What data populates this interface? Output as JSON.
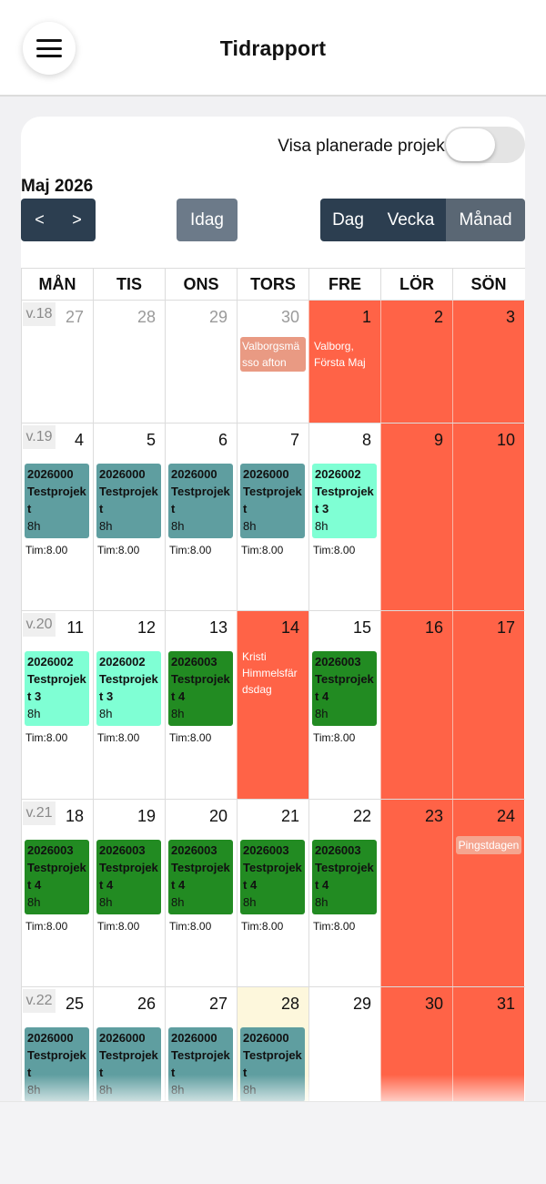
{
  "header": {
    "title": "Tidrapport",
    "menu_icon": "hamburger-icon"
  },
  "toolbar": {
    "toggle_label": "Visa planerade projekt",
    "toggle_on": false,
    "month": "Maj 2026",
    "prev": "<",
    "next": ">",
    "today": "Idag",
    "views": [
      "Dag",
      "Vecka",
      "Månad"
    ],
    "active_view": "Månad"
  },
  "colors": {
    "weekend": "#ff6347",
    "teal": "#5f9ea0",
    "aqua": "#7fffd4",
    "green": "#228b22",
    "nav": "#2c3e50"
  },
  "calendar": {
    "weekdays": [
      "MÅN",
      "TIS",
      "ONS",
      "TORS",
      "FRE",
      "LÖR",
      "SÖN"
    ],
    "weeks": [
      {
        "label": "v.18",
        "days": [
          {
            "n": "27"
          },
          {
            "n": "28"
          },
          {
            "n": "29"
          },
          {
            "n": "30",
            "holiday": "Valborgsmä sso afton"
          },
          {
            "n": "1",
            "holiday": "Valborg, Första Maj"
          },
          {
            "n": "2"
          },
          {
            "n": "3"
          }
        ]
      },
      {
        "label": "v.19",
        "days": [
          {
            "n": "4",
            "code": "2026000",
            "name": "Testprojek t",
            "hours": "8h",
            "tim": "Tim:8.00"
          },
          {
            "n": "5",
            "code": "2026000",
            "name": "Testprojek t",
            "hours": "8h",
            "tim": "Tim:8.00"
          },
          {
            "n": "6",
            "code": "2026000",
            "name": "Testprojek t",
            "hours": "8h",
            "tim": "Tim:8.00"
          },
          {
            "n": "7",
            "code": "2026000",
            "name": "Testprojek t",
            "hours": "8h",
            "tim": "Tim:8.00"
          },
          {
            "n": "8",
            "code": "2026002",
            "name": "Testprojek t 3",
            "hours": "8h",
            "tim": "Tim:8.00"
          },
          {
            "n": "9"
          },
          {
            "n": "10"
          }
        ]
      },
      {
        "label": "v.20",
        "days": [
          {
            "n": "11",
            "code": "2026002",
            "name": "Testprojek t 3",
            "hours": "8h",
            "tim": "Tim:8.00"
          },
          {
            "n": "12",
            "code": "2026002",
            "name": "Testprojek t 3",
            "hours": "8h",
            "tim": "Tim:8.00"
          },
          {
            "n": "13",
            "code": "2026003",
            "name": "Testprojek t 4",
            "hours": "8h",
            "tim": "Tim:8.00"
          },
          {
            "n": "14",
            "holiday": "Kristi Himmelsfär dsdag"
          },
          {
            "n": "15",
            "code": "2026003",
            "name": "Testprojek t 4",
            "hours": "8h",
            "tim": "Tim:8.00"
          },
          {
            "n": "16"
          },
          {
            "n": "17"
          }
        ]
      },
      {
        "label": "v.21",
        "days": [
          {
            "n": "18",
            "code": "2026003",
            "name": "Testprojek t 4",
            "hours": "8h",
            "tim": "Tim:8.00"
          },
          {
            "n": "19",
            "code": "2026003",
            "name": "Testprojek t 4",
            "hours": "8h",
            "tim": "Tim:8.00"
          },
          {
            "n": "20",
            "code": "2026003",
            "name": "Testprojek t 4",
            "hours": "8h",
            "tim": "Tim:8.00"
          },
          {
            "n": "21",
            "code": "2026003",
            "name": "Testprojek t 4",
            "hours": "8h",
            "tim": "Tim:8.00"
          },
          {
            "n": "22",
            "code": "2026003",
            "name": "Testprojek t 4",
            "hours": "8h",
            "tim": "Tim:8.00"
          },
          {
            "n": "23"
          },
          {
            "n": "24",
            "holiday": "Pingstdagen"
          }
        ]
      },
      {
        "label": "v.22",
        "days": [
          {
            "n": "25",
            "code": "2026000",
            "name": "Testprojek t",
            "hours": "8h"
          },
          {
            "n": "26",
            "code": "2026000",
            "name": "Testprojek t",
            "hours": "8h"
          },
          {
            "n": "27",
            "code": "2026000",
            "name": "Testprojek t",
            "hours": "8h"
          },
          {
            "n": "28",
            "code": "2026000",
            "name": "Testprojek t",
            "hours": "8h"
          },
          {
            "n": "29"
          },
          {
            "n": "30"
          },
          {
            "n": "31"
          }
        ]
      }
    ]
  }
}
